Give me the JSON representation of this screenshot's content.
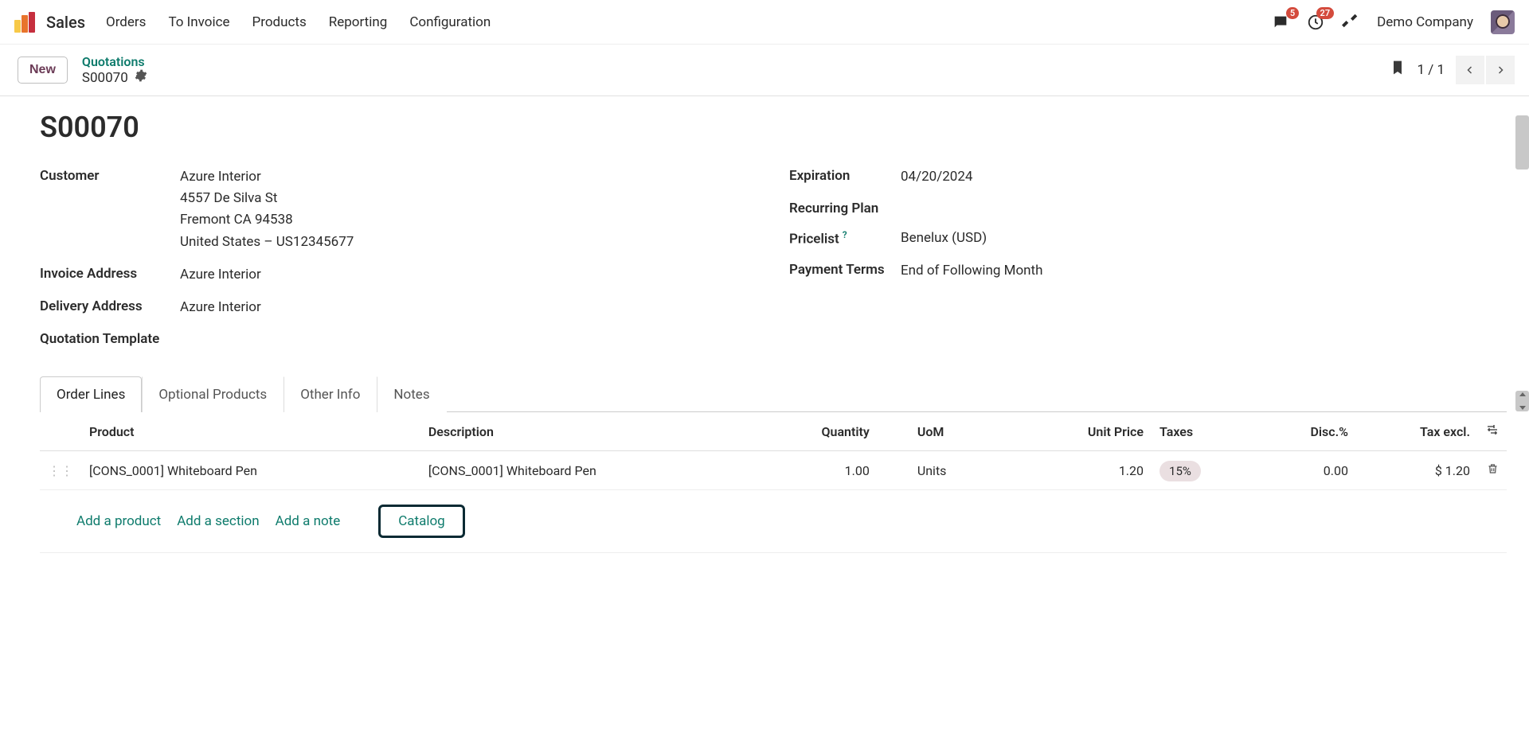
{
  "nav": {
    "app": "Sales",
    "items": [
      "Orders",
      "To Invoice",
      "Products",
      "Reporting",
      "Configuration"
    ],
    "chat_badge": "5",
    "clock_badge": "27",
    "company": "Demo Company"
  },
  "actionbar": {
    "new_label": "New",
    "breadcrumb_parent": "Quotations",
    "breadcrumb_current": "S00070",
    "pager": "1 / 1"
  },
  "doc": {
    "title": "S00070",
    "left": {
      "customer_label": "Customer",
      "customer_name": "Azure Interior",
      "customer_street": "4557 De Silva St",
      "customer_city": "Fremont CA 94538",
      "customer_country": "United States – US12345677",
      "invoice_label": "Invoice Address",
      "invoice_value": "Azure Interior",
      "delivery_label": "Delivery Address",
      "delivery_value": "Azure Interior",
      "template_label": "Quotation Template"
    },
    "right": {
      "expiration_label": "Expiration",
      "expiration_value": "04/20/2024",
      "recurring_label": "Recurring Plan",
      "pricelist_label": "Pricelist",
      "pricelist_value": "Benelux (USD)",
      "terms_label": "Payment Terms",
      "terms_value": "End of Following Month"
    }
  },
  "tabs": [
    "Order Lines",
    "Optional Products",
    "Other Info",
    "Notes"
  ],
  "table": {
    "headers": {
      "product": "Product",
      "description": "Description",
      "quantity": "Quantity",
      "uom": "UoM",
      "unit_price": "Unit Price",
      "taxes": "Taxes",
      "disc": "Disc.%",
      "tax_excl": "Tax excl."
    },
    "rows": [
      {
        "product": "[CONS_0001] Whiteboard Pen",
        "description": "[CONS_0001] Whiteboard Pen",
        "quantity": "1.00",
        "uom": "Units",
        "unit_price": "1.20",
        "taxes": "15%",
        "disc": "0.00",
        "tax_excl": "$ 1.20"
      }
    ],
    "actions": {
      "add_product": "Add a product",
      "add_section": "Add a section",
      "add_note": "Add a note",
      "catalog": "Catalog"
    }
  }
}
